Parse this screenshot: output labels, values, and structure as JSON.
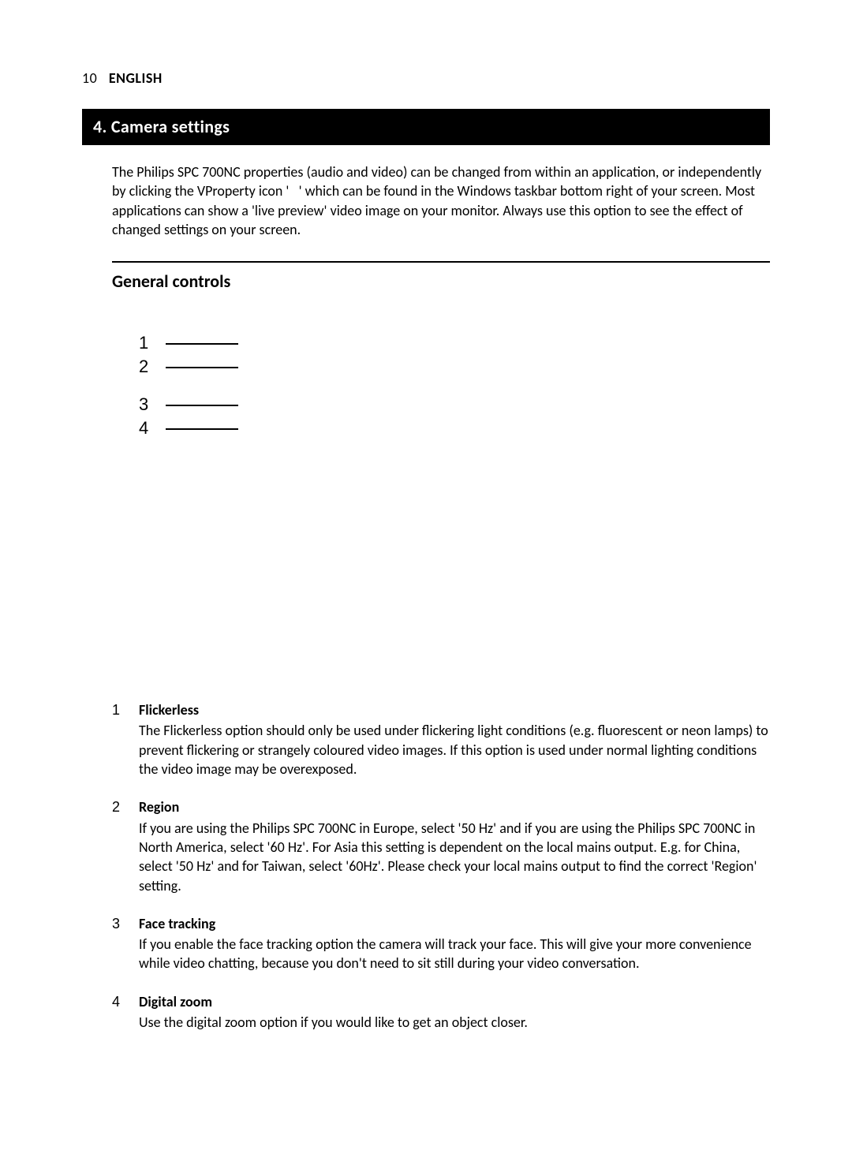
{
  "header": {
    "page_number": "10",
    "language": "ENGLISH"
  },
  "section_title": "4. Camera settings",
  "intro": "The Philips SPC 700NC properties (audio and video) can be changed from within an application, or independently by clicking the VProperty icon '   ' which can be found in the Windows taskbar bottom right of your screen. Most applications can show a 'live preview' video image on your monitor. Always use this option to see the effect of changed settings on your screen.",
  "sub_heading": "General controls",
  "callouts": [
    "1",
    "2",
    "3",
    "4"
  ],
  "items": [
    {
      "num": "1",
      "title": "Flickerless",
      "body": "The Flickerless option should only be used under flickering light conditions (e.g. fluorescent or neon lamps) to prevent flickering or strangely coloured video images. If this option is used under normal lighting conditions the video image may be overexposed."
    },
    {
      "num": "2",
      "title": "Region",
      "body": "If you are using the Philips SPC 700NC in Europe, select '50 Hz' and if you are using the Philips SPC 700NC in North America, select '60 Hz'. For Asia this setting is dependent on the local mains output. E.g. for China, select '50 Hz' and for Taiwan, select '60Hz'. Please check your local mains output to find the correct 'Region' setting."
    },
    {
      "num": "3",
      "title": "Face tracking",
      "body": "If you enable the face tracking option the camera will track your face. This will give your more convenience while video chatting, because you don't need to sit still during your video conversation."
    },
    {
      "num": "4",
      "title": "Digital zoom",
      "body": "Use the digital zoom option if you would like to get an object closer."
    }
  ]
}
